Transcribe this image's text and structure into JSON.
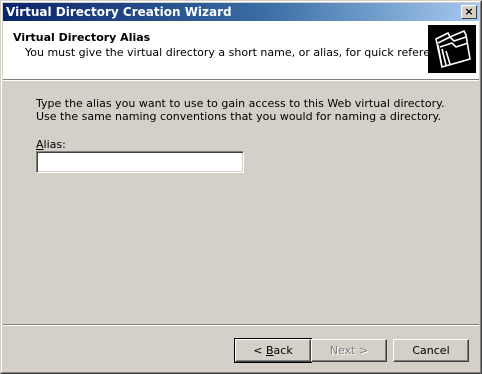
{
  "window": {
    "title": "Virtual Directory Creation Wizard",
    "close_glyph": "×"
  },
  "header": {
    "title": "Virtual Directory Alias",
    "subtitle": "You must give the virtual directory a short name, or alias, for quick reference.",
    "icon": "folder-documents-icon"
  },
  "body": {
    "instruction": "Type the alias you want to use to gain access to this Web virtual directory. Use the same naming conventions that you would for naming a directory.",
    "alias_label_accel": "A",
    "alias_label_rest": "lias:",
    "alias_value": ""
  },
  "buttons": {
    "back_prefix": "< ",
    "back_accel": "B",
    "back_rest": "ack",
    "next_label": "Next >",
    "cancel_label": "Cancel"
  }
}
